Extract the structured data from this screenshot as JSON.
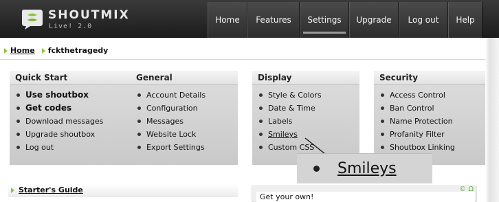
{
  "app": {
    "brand": "SHOUTMIX",
    "subtitle": "Live! 2.0"
  },
  "nav": {
    "items": [
      {
        "label": "Home",
        "width": 58,
        "active": false
      },
      {
        "label": "Features",
        "width": 76,
        "active": false
      },
      {
        "label": "Settings",
        "width": 72,
        "active": true
      },
      {
        "label": "Upgrade",
        "width": 72,
        "active": false
      },
      {
        "label": "Log out",
        "width": 72,
        "active": false
      },
      {
        "label": "Help",
        "width": 50,
        "active": false
      }
    ]
  },
  "breadcrumb": {
    "home": "Home",
    "current": "fckthetragedy"
  },
  "panels": {
    "quick_start": {
      "title": "Quick Start",
      "items": [
        "Use shoutbox",
        "Get codes",
        "Download messages",
        "Upgrade shoutbox",
        "Log out"
      ]
    },
    "general": {
      "title": "General",
      "items": [
        "Account Details",
        "Configuration",
        "Messages",
        "Website Lock",
        "Export Settings"
      ]
    },
    "display": {
      "title": "Display",
      "items": [
        "Style & Colors",
        "Date & Time",
        "Labels",
        "Smileys",
        "Custom CSS"
      ]
    },
    "security": {
      "title": "Security",
      "items": [
        "Access Control",
        "Ban Control",
        "Name Protection",
        "Profanity Filter",
        "Shoutbox Linking"
      ]
    }
  },
  "zoom_callout": {
    "label": "Smileys"
  },
  "guide": {
    "label": "Starter's Guide"
  },
  "get_own": {
    "text": "Get your own!",
    "icons": "© Ω"
  },
  "colors": {
    "accent_green": "#8dc63f",
    "header_dark": "#2a2a2a",
    "panel_gray": "#d2d2d2"
  }
}
